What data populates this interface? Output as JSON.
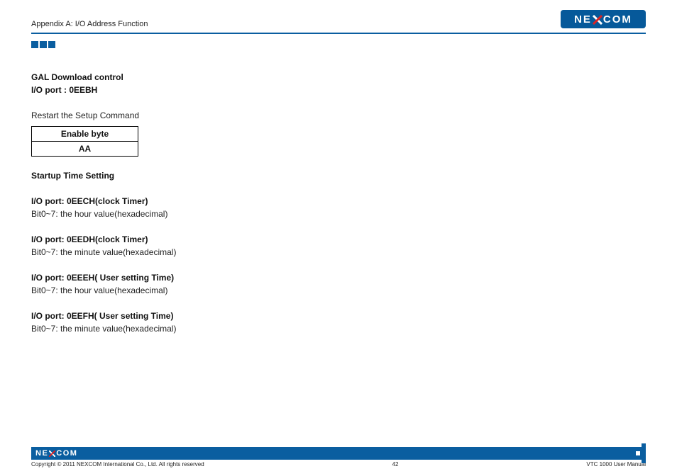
{
  "header": {
    "appendix": "Appendix A: I/O Address Function",
    "logo_left": "NE",
    "logo_right": "COM"
  },
  "section1": {
    "title1": "GAL Download control",
    "title2": "I/O port : 0EEBH",
    "restart_label": "Restart the Setup Command",
    "table_head": "Enable byte",
    "table_val": "AA"
  },
  "section2": {
    "title": "Startup Time Setting"
  },
  "port1": {
    "title": "I/O port: 0EECH(clock Timer)",
    "desc": "Bit0~7: the hour value(hexadecimal)"
  },
  "port2": {
    "title": "I/O port: 0EEDH(clock Timer)",
    "desc": "Bit0~7: the minute value(hexadecimal)"
  },
  "port3": {
    "title": "I/O port: 0EEEH( User setting Time)",
    "desc": "Bit0~7: the hour value(hexadecimal)"
  },
  "port4": {
    "title": "I/O port: 0EEFH( User setting Time)",
    "desc": "Bit0~7: the minute value(hexadecimal)"
  },
  "footer": {
    "logo_left": "NE",
    "logo_right": "COM",
    "copyright": "Copyright © 2011 NEXCOM International Co., Ltd. All rights reserved",
    "page": "42",
    "manual": "VTC 1000 User Manual"
  }
}
